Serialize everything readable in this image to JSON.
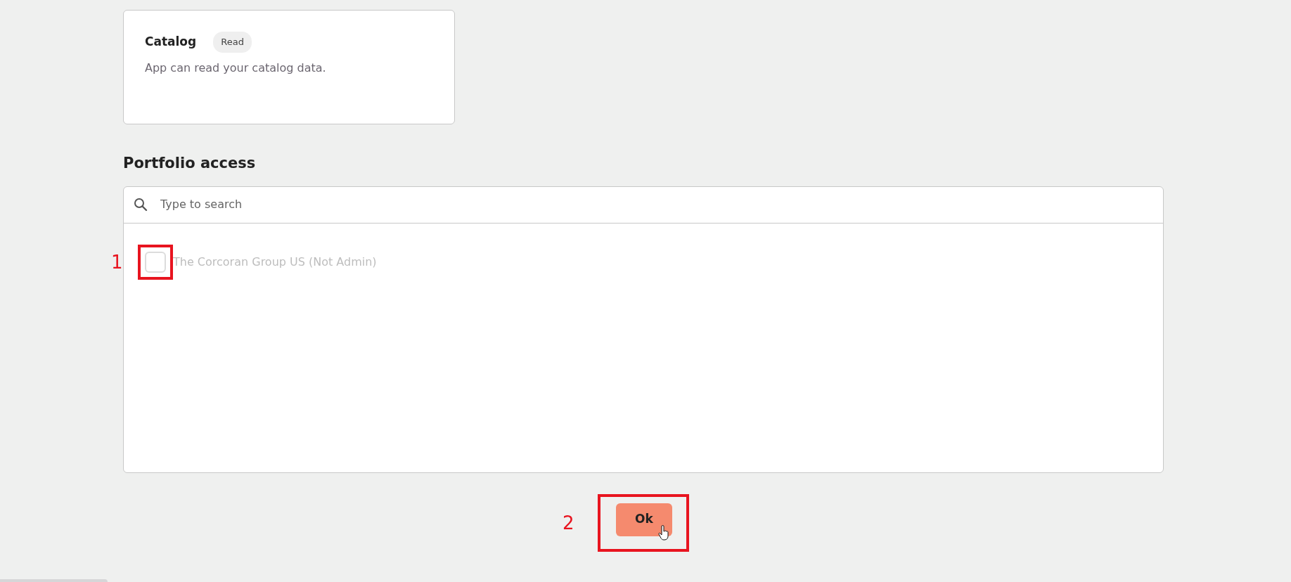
{
  "permission_card": {
    "title": "Catalog",
    "badge": "Read",
    "description": "App can read your catalog data."
  },
  "section_title": "Portfolio access",
  "search": {
    "placeholder": "Type to search"
  },
  "portfolios": [
    {
      "label": "The Corcoran Group US (Not Admin)",
      "checked": false,
      "disabled": true,
      "annotation": "1"
    }
  ],
  "ok_button": {
    "label": "Ok",
    "annotation": "2"
  }
}
